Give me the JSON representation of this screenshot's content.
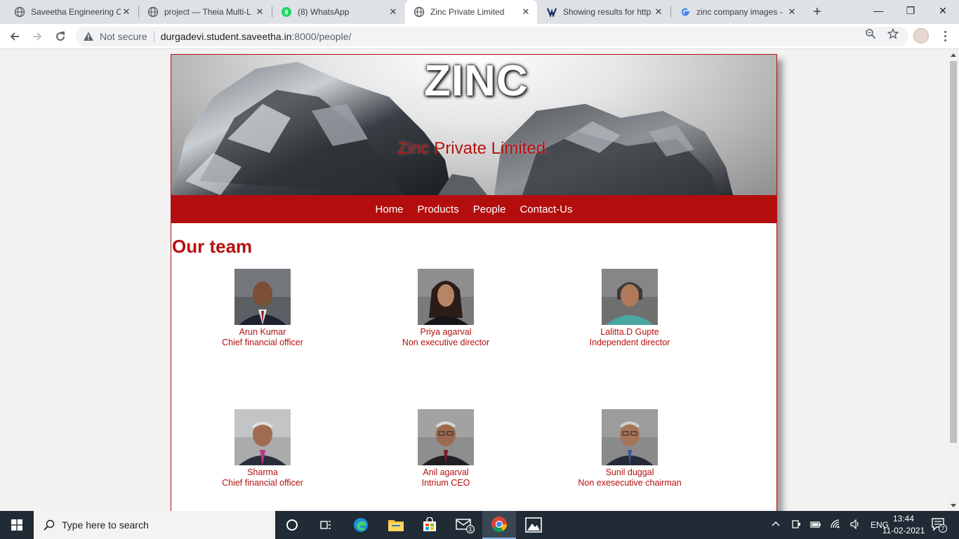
{
  "browser": {
    "tabs": [
      {
        "title": "Saveetha Engineering C",
        "icon": "globe-icon",
        "active": false
      },
      {
        "title": "project — Theia Multi-L",
        "icon": "globe-icon",
        "active": false
      },
      {
        "title": "(8) WhatsApp",
        "icon": "whatsapp-icon",
        "active": false
      },
      {
        "title": "Zinc Private Limited",
        "icon": "globe-icon",
        "active": true
      },
      {
        "title": "Showing results for http",
        "icon": "search-brand-icon",
        "active": false
      },
      {
        "title": "zinc company images -",
        "icon": "google-icon",
        "active": false
      }
    ],
    "security_label": "Not secure",
    "url_host": "durgadevi.student.saveetha.in",
    "url_path": ":8000/people/"
  },
  "site": {
    "logo_text": "ZINC",
    "company_name": "Zinc Private Limited.",
    "nav": [
      "Home",
      "Products",
      "People",
      "Contact-Us"
    ],
    "heading": "Our team",
    "team": [
      {
        "name": "Arun Kumar",
        "role": "Chief financial officer"
      },
      {
        "name": "Priya agarval",
        "role": "Non executive director"
      },
      {
        "name": "Lalitta.D Gupte",
        "role": "Independent director"
      },
      {
        "name": "Sharma",
        "role": "Chief financial officer"
      },
      {
        "name": "Anil agarval",
        "role": "Intrium CEO"
      },
      {
        "name": "Sunil duggal",
        "role": "Non exesecutive chairman"
      }
    ],
    "accent_color": "#b40d0d"
  },
  "taskbar": {
    "search_placeholder": "Type here to search",
    "language": "ENG",
    "time": "13:44",
    "date": "11-02-2021",
    "notification_count": "7",
    "mail_badge": "1"
  }
}
